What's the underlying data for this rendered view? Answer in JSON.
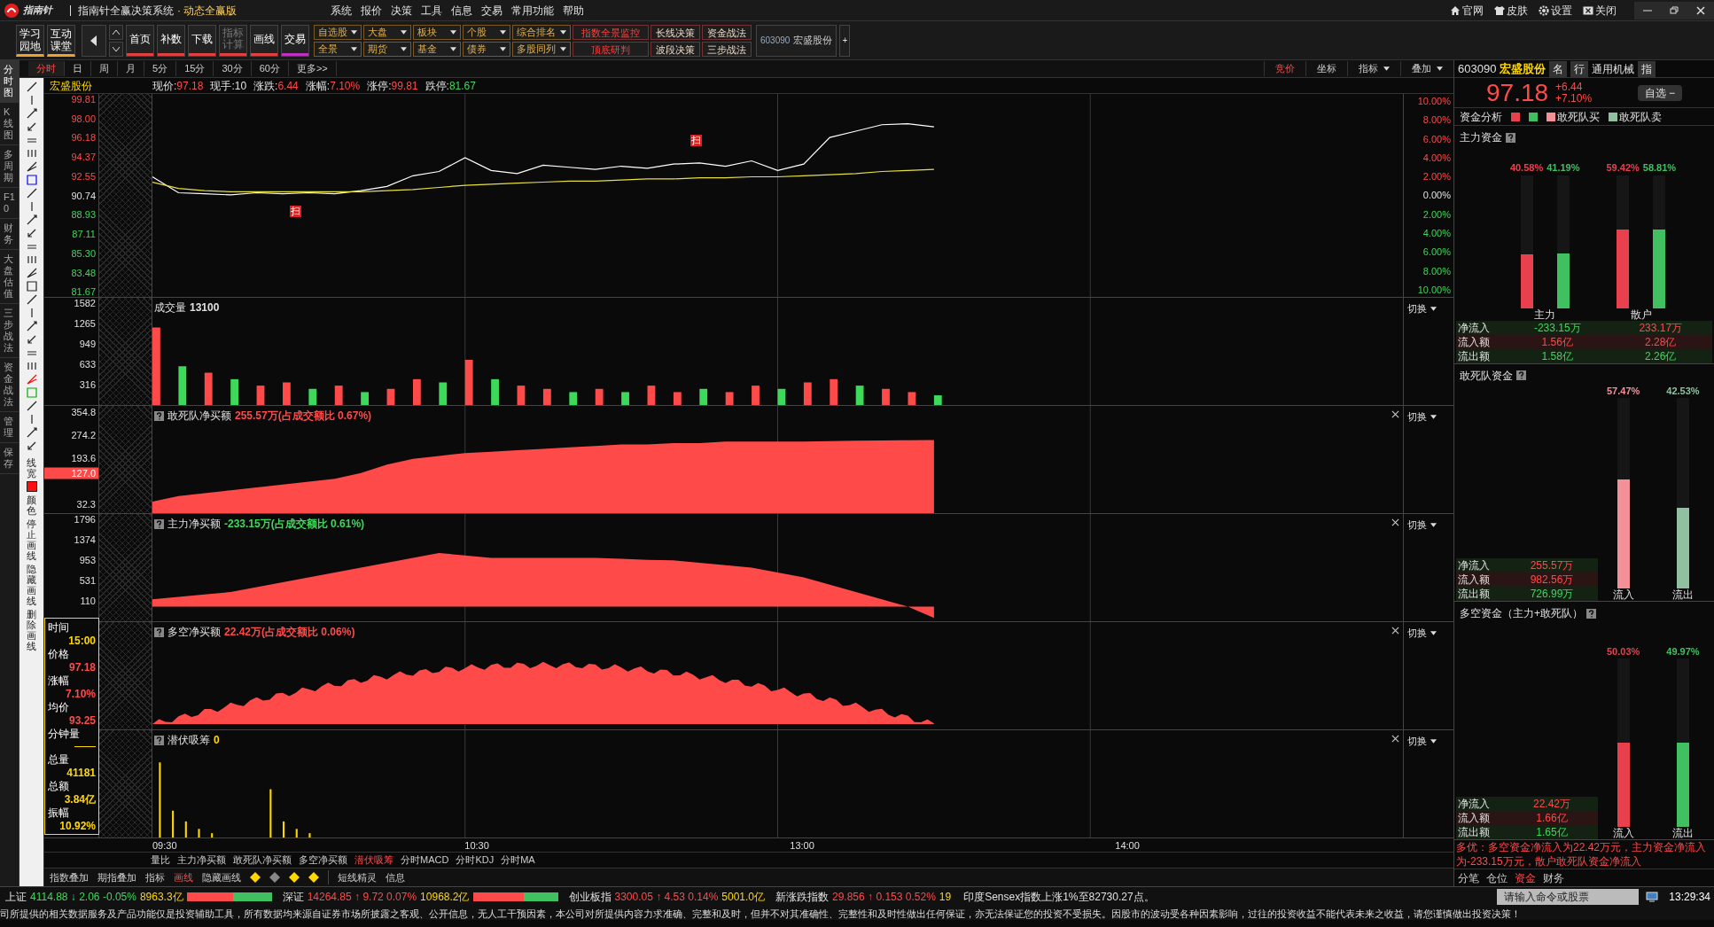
{
  "title_bar": {
    "logo": "指南针",
    "title": "指南针全赢决策系统",
    "edition": "· 动态全赢版",
    "menu": [
      "系统",
      "报价",
      "决策",
      "工具",
      "信息",
      "交易",
      "常用功能",
      "帮助"
    ],
    "links": [
      {
        "kind": "home",
        "label": "官网"
      },
      {
        "kind": "shirt",
        "label": "皮肤"
      },
      {
        "kind": "gear",
        "label": "设置"
      },
      {
        "kind": "close",
        "label": "关闭"
      }
    ]
  },
  "toolbar": {
    "big_buttons": [
      {
        "label": "学习园地"
      },
      {
        "label": "互动课堂"
      }
    ],
    "nav_buttons": [
      {
        "label": "首页",
        "color": "#e04040",
        "disabled": false
      },
      {
        "label": "补数",
        "color": "#e04040",
        "disabled": false
      },
      {
        "label": "下载",
        "color": "#e04040",
        "disabled": false
      },
      {
        "label": "指标计算",
        "color": "#e04040",
        "disabled": true
      },
      {
        "label": "画线",
        "color": "#e04040",
        "disabled": false
      },
      {
        "label": "交易",
        "color": "#c030c0",
        "disabled": false
      }
    ],
    "menu_rows": [
      [
        {
          "label": "自选股",
          "kind": "dropdown"
        },
        {
          "label": "大盘",
          "kind": "dropdown"
        },
        {
          "label": "板块",
          "kind": "dropdown"
        },
        {
          "label": "个股",
          "kind": "dropdown"
        },
        {
          "label": "综合排名",
          "kind": "dropdown"
        },
        {
          "label": "指数全景监控",
          "kind": "button",
          "highlight": true
        },
        {
          "label": "长线决策",
          "kind": "button",
          "highlight": false
        },
        {
          "label": "资金战法",
          "kind": "button",
          "highlight": false
        }
      ],
      [
        {
          "label": "全景",
          "kind": "dropdown"
        },
        {
          "label": "期货",
          "kind": "dropdown"
        },
        {
          "label": "基金",
          "kind": "dropdown"
        },
        {
          "label": "债券",
          "kind": "dropdown"
        },
        {
          "label": "多股同列",
          "kind": "dropdown"
        },
        {
          "label": "顶底研判",
          "kind": "button",
          "highlight": true
        },
        {
          "label": "波段决策",
          "kind": "button",
          "highlight": false
        },
        {
          "label": "三步战法",
          "kind": "button",
          "highlight": false
        }
      ]
    ],
    "stock": {
      "code": "603090",
      "name": "宏盛股份"
    },
    "plus": "+"
  },
  "side_tabs": [
    {
      "label": "分时图",
      "selected": true
    },
    {
      "label": "K线图",
      "selected": false
    },
    {
      "label": "多周期",
      "selected": false
    },
    {
      "label": "F10",
      "selected": false
    },
    {
      "label": "财务",
      "selected": false
    },
    {
      "label": "大盘估值",
      "selected": false
    },
    {
      "label": "三步战法",
      "selected": false
    },
    {
      "label": "资金战法",
      "selected": false
    },
    {
      "label": "管理",
      "selected": false
    },
    {
      "label": "保存",
      "selected": false
    }
  ],
  "period_tabs": [
    {
      "label": "分时",
      "selected": true
    },
    {
      "label": "日",
      "selected": false
    },
    {
      "label": "周",
      "selected": false
    },
    {
      "label": "月",
      "selected": false
    },
    {
      "label": "5分",
      "selected": false
    },
    {
      "label": "15分",
      "selected": false
    },
    {
      "label": "30分",
      "selected": false
    },
    {
      "label": "60分",
      "selected": false
    },
    {
      "label": "更多>>",
      "selected": false
    }
  ],
  "chart_tools": [
    {
      "label": "竞价",
      "selected": true,
      "dropdown": false
    },
    {
      "label": "坐标",
      "selected": false,
      "dropdown": false
    },
    {
      "label": "指标",
      "selected": false,
      "dropdown": true
    },
    {
      "label": "叠加",
      "selected": false,
      "dropdown": true
    }
  ],
  "quote_line": {
    "name": "宏盛股份",
    "fields": [
      {
        "label": "现价:",
        "value": "97.18",
        "color": "#ff4a4a"
      },
      {
        "label": "现手:",
        "value": "10",
        "color": "#e0e0e0"
      },
      {
        "label": "涨跌:",
        "value": "6.44",
        "color": "#ff4a4a"
      },
      {
        "label": "涨幅:",
        "value": "7.10%",
        "color": "#ff4a4a"
      },
      {
        "label": "涨停:",
        "value": "99.81",
        "color": "#ff4a4a"
      },
      {
        "label": "跌停:",
        "value": "81.67",
        "color": "#3ed85a"
      }
    ]
  },
  "drawing_tools": {
    "line_width": "线宽",
    "color_label": "颜色",
    "actions": [
      "停止画线",
      "隐藏画线",
      "删除画线"
    ]
  },
  "price_panel": {
    "chart_data": {
      "type": "line",
      "grid": true,
      "ylim": [
        81.2,
        100.3
      ],
      "categories": [
        null,
        null,
        null,
        null,
        null,
        null,
        null,
        null,
        null,
        null,
        null,
        null,
        null,
        null,
        null,
        null,
        null,
        null,
        null,
        null,
        null,
        null,
        null,
        null,
        null,
        null,
        null,
        null,
        null,
        null,
        null,
        null,
        null,
        null,
        null,
        null,
        null,
        null,
        null,
        null,
        null,
        null,
        null,
        null,
        null,
        null,
        null,
        null,
        null
      ],
      "yticks": [
        {
          "value": 99.81,
          "label": "99.81"
        },
        {
          "value": 98.0,
          "label": "98.00"
        },
        {
          "value": 96.18,
          "label": "96.18"
        },
        {
          "value": 94.37,
          "label": "94.37"
        },
        {
          "value": 92.55,
          "label": "92.55"
        },
        {
          "value": 90.74,
          "label": "90.74"
        },
        {
          "value": 88.93,
          "label": "88.93"
        },
        {
          "value": 87.11,
          "label": "87.11"
        },
        {
          "value": 85.3,
          "label": "85.30"
        },
        {
          "value": 83.48,
          "label": "83.48"
        },
        {
          "value": 81.67,
          "label": "81.67"
        }
      ],
      "series": [
        {
          "color": "#ffffff",
          "values": [
            92.5,
            91.0,
            90.9,
            90.8,
            91.0,
            90.9,
            91.0,
            90.9,
            91.2,
            91.6,
            92.6,
            93.0,
            94.3,
            93.1,
            92.8,
            93.6,
            93.4,
            93.2,
            93.5,
            93.3,
            93.7,
            93.8,
            93.5,
            94.0,
            93.1,
            93.7,
            96.2,
            96.8,
            97.4,
            97.5,
            97.2,
            null,
            null,
            null,
            null,
            null,
            null,
            null,
            null,
            null,
            null,
            null,
            null,
            null,
            null,
            null,
            null,
            null,
            null
          ]
        },
        {
          "color": "#e8e040",
          "values": [
            92.0,
            91.4,
            91.2,
            91.1,
            91.1,
            91.1,
            91.1,
            91.1,
            91.1,
            91.2,
            91.3,
            91.5,
            91.7,
            91.8,
            91.9,
            92.0,
            92.1,
            92.1,
            92.2,
            92.3,
            92.3,
            92.4,
            92.4,
            92.5,
            92.5,
            92.6,
            92.7,
            92.8,
            93.0,
            93.1,
            93.2,
            null,
            null,
            null,
            null,
            null,
            null,
            null,
            null,
            null,
            null,
            null,
            null,
            null,
            null,
            null,
            null,
            null,
            null
          ]
        }
      ]
    },
    "pct_axis": [
      "10.00%",
      "8.00%",
      "6.00%",
      "4.00%",
      "2.00%",
      "0.00%",
      "2.00%",
      "4.00%",
      "6.00%",
      "8.00%",
      "10.00%"
    ],
    "markers": [
      "扫",
      "扫"
    ]
  },
  "sub_panels": [
    {
      "kind": "chart",
      "title": "成交量",
      "value": "13100",
      "color": "#e0e0e0",
      "closable": false,
      "switch": "切换",
      "chart_data": {
        "type": "bar",
        "grid": true,
        "ylim": [
          0,
          1660
        ],
        "categories": [
          null,
          null,
          null,
          null,
          null,
          null,
          null,
          null,
          null,
          null,
          null,
          null,
          null,
          null,
          null,
          null,
          null,
          null,
          null,
          null,
          null,
          null,
          null,
          null,
          null,
          null,
          null,
          null,
          null,
          null,
          null,
          null,
          null,
          null,
          null,
          null,
          null,
          null,
          null,
          null,
          null,
          null,
          null,
          null,
          null,
          null,
          null,
          null,
          null
        ],
        "yticks": [
          {
            "value": 1582,
            "label": "1582"
          },
          {
            "value": 1265,
            "label": "1265"
          },
          {
            "value": 949,
            "label": "949"
          },
          {
            "value": 633,
            "label": "633"
          },
          {
            "value": 316,
            "label": "316"
          }
        ],
        "series": [
          {
            "color": "#ff4a4a",
            "values": [
              1200,
              null,
              500,
              null,
              300,
              350,
              null,
              300,
              null,
              250,
              400,
              null,
              700,
              null,
              300,
              250,
              null,
              250,
              null,
              300,
              200,
              null,
              200,
              300,
              null,
              350,
              400,
              null,
              250,
              200,
              null,
              null,
              null,
              null,
              null,
              null,
              null,
              null,
              null,
              null,
              null,
              null,
              null,
              null,
              null,
              null,
              null,
              null,
              null
            ]
          },
          {
            "color": "#3ed85a",
            "values": [
              null,
              600,
              null,
              400,
              null,
              null,
              250,
              null,
              200,
              null,
              null,
              350,
              null,
              400,
              null,
              null,
              200,
              null,
              200,
              null,
              null,
              250,
              null,
              null,
              250,
              null,
              null,
              300,
              null,
              null,
              150,
              null,
              null,
              null,
              null,
              null,
              null,
              null,
              null,
              null,
              null,
              null,
              null,
              null,
              null,
              null,
              null,
              null,
              null
            ]
          }
        ]
      }
    },
    {
      "kind": "chart",
      "title": "敢死队净买额",
      "value": "255.57万(占成交额比 0.67%)",
      "color": "#ff4a4a",
      "cursor_value": "127.0",
      "closable": true,
      "switch": "切换",
      "chart_data": {
        "type": "area",
        "grid": true,
        "ylim": [
          0,
          375
        ],
        "categories": [
          null,
          null,
          null,
          null,
          null,
          null,
          null,
          null,
          null,
          null,
          null,
          null,
          null,
          null,
          null,
          null,
          null,
          null,
          null,
          null,
          null,
          null,
          null,
          null,
          null,
          null,
          null,
          null,
          null,
          null,
          null,
          null,
          null,
          null,
          null,
          null,
          null,
          null,
          null,
          null,
          null,
          null,
          null,
          null,
          null,
          null,
          null,
          null,
          null
        ],
        "yticks": [
          {
            "value": 354.8,
            "label": "354.8"
          },
          {
            "value": 274.2,
            "label": "274.2"
          },
          {
            "value": 193.6,
            "label": "193.6"
          },
          {
            "value": 32.3,
            "label": "32.3"
          }
        ],
        "series": [
          {
            "color": "#ff4a4a",
            "values": [
              40,
              60,
              70,
              80,
              90,
              100,
              110,
              120,
              140,
              170,
              190,
              200,
              210,
              215,
              220,
              225,
              230,
              235,
              240,
              240,
              245,
              245,
              250,
              250,
              250,
              250,
              252,
              253,
              254,
              255,
              256,
              null,
              null,
              null,
              null,
              null,
              null,
              null,
              null,
              null,
              null,
              null,
              null,
              null,
              null,
              null,
              null,
              null,
              null
            ]
          }
        ]
      }
    },
    {
      "kind": "chart",
      "title": "主力净买额",
      "value": "-233.15万(占成交额比 0.61%)",
      "color": "#3ed85a",
      "closable": true,
      "switch": "切换",
      "chart_data": {
        "type": "area",
        "grid": true,
        "ylim": [
          -300,
          1900
        ],
        "categories": [
          null,
          null,
          null,
          null,
          null,
          null,
          null,
          null,
          null,
          null,
          null,
          null,
          null,
          null,
          null,
          null,
          null,
          null,
          null,
          null,
          null,
          null,
          null,
          null,
          null,
          null,
          null,
          null,
          null,
          null,
          null,
          null,
          null,
          null,
          null,
          null,
          null,
          null,
          null,
          null,
          null,
          null,
          null,
          null,
          null,
          null,
          null,
          null,
          null
        ],
        "yticks": [
          {
            "value": 1796,
            "label": "1796"
          },
          {
            "value": 1374,
            "label": "1374"
          },
          {
            "value": 953,
            "label": "953"
          },
          {
            "value": 531,
            "label": "531"
          },
          {
            "value": 110,
            "label": "110"
          }
        ],
        "series": [
          {
            "color": "#ff4a4a",
            "values": [
              150,
              200,
              250,
              300,
              400,
              500,
              600,
              700,
              800,
              900,
              1000,
              1100,
              1050,
              1000,
              1000,
              1000,
              1000,
              1000,
              980,
              960,
              950,
              900,
              850,
              800,
              700,
              600,
              450,
              300,
              150,
              0,
              -230,
              null,
              null,
              null,
              null,
              null,
              null,
              null,
              null,
              null,
              null,
              null,
              null,
              null,
              null,
              null,
              null,
              null,
              null
            ]
          }
        ]
      }
    },
    {
      "kind": "hump",
      "title": "多空净买额",
      "value": "22.42万(占成交额比 0.06%)",
      "color": "#ff4a4a",
      "closable": true,
      "switch": "切换"
    },
    {
      "kind": "spikes",
      "title": "潜伏吸筹",
      "value": "0",
      "color": "#ffd700",
      "closable": true,
      "switch": "切换"
    }
  ],
  "cursor_info": [
    {
      "label": "时间",
      "value": "15:00",
      "color": "#ffd700"
    },
    {
      "label": "价格",
      "value": "97.18",
      "color": "#ff4a4a"
    },
    {
      "label": "涨幅",
      "value": "7.10%",
      "color": "#ff4a4a"
    },
    {
      "label": "均价",
      "value": "93.25",
      "color": "#ff4a4a"
    },
    {
      "label": "分钟量"
    },
    {
      "label": "总量",
      "value": "41181",
      "color": "#ffd700"
    },
    {
      "label": "总额",
      "value": "3.84亿",
      "color": "#ffd700"
    },
    {
      "label": "振幅",
      "value": "10.92%",
      "color": "#ffd700"
    }
  ],
  "time_axis": [
    "09:30",
    "10:30",
    "13:00",
    "14:00"
  ],
  "indicator_tabs": [
    {
      "label": "量比",
      "selected": false
    },
    {
      "label": "主力净买额",
      "selected": false
    },
    {
      "label": "敢死队净买额",
      "selected": false
    },
    {
      "label": "多空净买额",
      "selected": false
    },
    {
      "label": "潜伏吸筹",
      "selected": true
    },
    {
      "label": "分时MACD",
      "selected": false
    },
    {
      "label": "分时KDJ",
      "selected": false
    },
    {
      "label": "分时MA",
      "selected": false
    }
  ],
  "bottom_tools": {
    "items": [
      {
        "label": "指数叠加",
        "selected": false
      },
      {
        "label": "期指叠加",
        "selected": false
      },
      {
        "label": "指标",
        "selected": false
      },
      {
        "label": "画线",
        "selected": true
      },
      {
        "label": "隐藏画线",
        "selected": false
      }
    ],
    "extra": [
      "短线精灵",
      "信息"
    ]
  },
  "right_panel": {
    "code": "603090",
    "name": "宏盛股份",
    "tags": [
      "名",
      "行"
    ],
    "industry": "通用机械",
    "index_tag": "指",
    "price": "97.18",
    "change": "+6.44",
    "change_pct": "+7.10%",
    "watch": "自选 −",
    "legend_title": "资金分析",
    "legend": [
      {
        "color": "#e8404c"
      },
      {
        "color": "#40c060"
      },
      {
        "label": "敢死队买",
        "color": "#f49098"
      },
      {
        "label": "敢死队卖",
        "color": "#90c0a0"
      }
    ],
    "sections": [
      {
        "title": "主力资金",
        "groups": [
          {
            "label": "主力",
            "bars": [
              {
                "value": "40.58%",
                "level": 0.4058,
                "color": "#e8404c"
              },
              {
                "value": "41.19%",
                "level": 0.4119,
                "color": "#40c060"
              }
            ]
          },
          {
            "label": "散户",
            "bars": [
              {
                "value": "59.42%",
                "level": 0.5942,
                "color": "#e8404c"
              },
              {
                "value": "58.81%",
                "level": 0.5881,
                "color": "#40c060"
              }
            ]
          }
        ],
        "rows": [
          {
            "label": "净流入",
            "values": [
              {
                "v": "-233.15万",
                "color": "#3ed85a"
              },
              {
                "v": "233.17万",
                "color": "#ff4a4a"
              }
            ]
          },
          {
            "label": "流入额",
            "values": [
              {
                "v": "1.56亿",
                "color": "#ff4a4a"
              },
              {
                "v": "2.28亿",
                "color": "#ff4a4a"
              }
            ]
          },
          {
            "label": "流出额",
            "values": [
              {
                "v": "1.58亿",
                "color": "#3ed85a"
              },
              {
                "v": "2.26亿",
                "color": "#3ed85a"
              }
            ]
          }
        ]
      },
      {
        "title": "敢死队资金",
        "groups": [
          {
            "label": "流入",
            "bars": [
              {
                "value": "57.47%",
                "level": 0.5747,
                "color": "#f49098"
              }
            ]
          },
          {
            "label": "流出",
            "bars": [
              {
                "value": "42.53%",
                "level": 0.4253,
                "color": "#90c0a0"
              }
            ]
          }
        ],
        "rows": [
          {
            "label": "净流入",
            "values": [
              {
                "v": "255.57万",
                "color": "#ff4a4a"
              }
            ]
          },
          {
            "label": "流入额",
            "values": [
              {
                "v": "982.56万",
                "color": "#ff4a4a"
              }
            ]
          },
          {
            "label": "流出额",
            "values": [
              {
                "v": "726.99万",
                "color": "#3ed85a"
              }
            ]
          }
        ]
      },
      {
        "title": "多空资金（主力+敢死队）",
        "groups": [
          {
            "label": "流入",
            "bars": [
              {
                "value": "50.03%",
                "level": 0.5003,
                "color": "#e8404c"
              }
            ]
          },
          {
            "label": "流出",
            "bars": [
              {
                "value": "49.97%",
                "level": 0.4997,
                "color": "#40c060"
              }
            ]
          }
        ],
        "rows": [
          {
            "label": "净流入",
            "values": [
              {
                "v": "22.42万",
                "color": "#ff4a4a"
              }
            ]
          },
          {
            "label": "流入额",
            "values": [
              {
                "v": "1.66亿",
                "color": "#ff4a4a"
              }
            ]
          },
          {
            "label": "流出额",
            "values": [
              {
                "v": "1.65亿",
                "color": "#3ed85a"
              }
            ]
          }
        ]
      }
    ],
    "summary": "多优：多空资金净流入为22.42万元，主力资金净流入为-233.15万元，散户敢死队资金净流入",
    "tabs": [
      {
        "label": "分笔",
        "selected": false
      },
      {
        "label": "仓位",
        "selected": false
      },
      {
        "label": "资金",
        "selected": true
      },
      {
        "label": "财务",
        "selected": false
      }
    ]
  },
  "index_bar": [
    {
      "name": "上证",
      "price": "4114.88",
      "arrow": "↓",
      "change": "2.06",
      "pct": "-0.05%",
      "amount": "8963.3亿",
      "color": "#3ed85a",
      "level": 0.55
    },
    {
      "name": "深证",
      "price": "14264.85",
      "arrow": "↑",
      "change": "9.72",
      "pct": "0.07%",
      "amount": "10968.2亿",
      "color": "#ff4a4a",
      "level": 0.6
    },
    {
      "name": "创业板指",
      "price": "3300.05",
      "arrow": "↑",
      "change": "4.53",
      "pct": "0.14%",
      "amount": "5001.0亿",
      "color": "#ff4a4a"
    },
    {
      "name": "新涨跌指数",
      "price": "29.856",
      "arrow": "↑",
      "change": "0.153",
      "pct": "0.52%",
      "amount": "19",
      "color": "#ff4a4a"
    }
  ],
  "news": "印度Sensex指数上涨1%至82730.27点。",
  "command": {
    "placeholder": "请输入命令或股票"
  },
  "clock": "13:29:34",
  "disclaimer": "司所提供的相关数据服务及产品功能仅是投资辅助工具，所有数据均来源自证券市场所披露之客观、公开信息，无人工干预因素，本公司对所提供内容力求准确、完整和及时，但并不对其准确性、完整性和及时性做出任何保证，亦无法保证您的投资不受损失。因股市的波动受各种因素影响，过往的投资收益不能代表未来之收益，请您谨慎做出投资决策！"
}
